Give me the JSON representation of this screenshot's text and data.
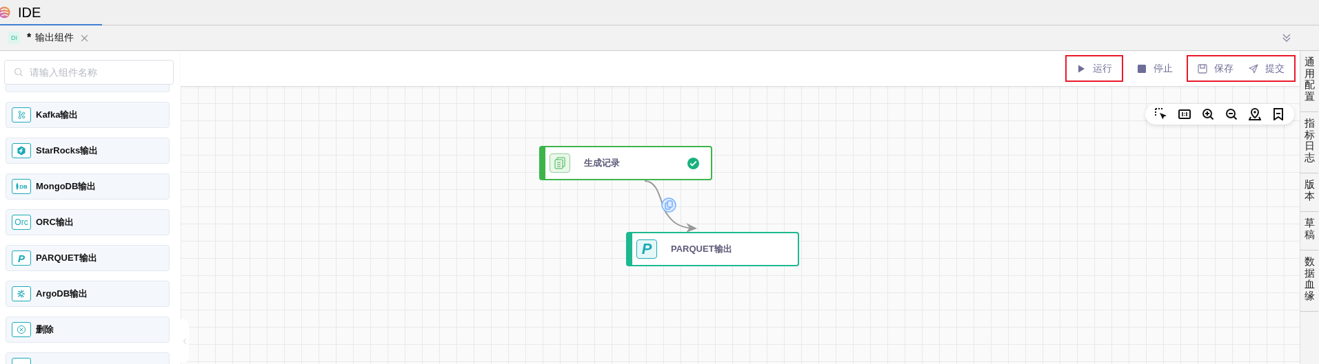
{
  "app": {
    "title": "IDE"
  },
  "tabs": [
    {
      "badge": "DI",
      "dirty_mark": "*",
      "label": "输出组件"
    }
  ],
  "search": {
    "placeholder": "请输入组件名称"
  },
  "components": [
    {
      "kind": "kafka",
      "label": "Kafka输出"
    },
    {
      "kind": "starrocks",
      "label": "StarRocks输出"
    },
    {
      "kind": "mongodb",
      "icon_text": "DB",
      "label": "MongoDB输出"
    },
    {
      "kind": "orc",
      "icon_text": "Orc",
      "label": "ORC输出"
    },
    {
      "kind": "parquet",
      "icon_text": "P",
      "label": "PARQUET输出"
    },
    {
      "kind": "argodb",
      "label": "ArgoDB输出"
    },
    {
      "kind": "delete",
      "label": "删除"
    }
  ],
  "toolbar": {
    "groups": [
      {
        "highlighted": true,
        "buttons": [
          {
            "kind": "run",
            "label": "运行"
          }
        ]
      },
      {
        "highlighted": false,
        "buttons": [
          {
            "kind": "stop",
            "label": "停止"
          }
        ]
      },
      {
        "highlighted": true,
        "buttons": [
          {
            "kind": "save",
            "label": "保存"
          },
          {
            "kind": "submit",
            "label": "提交"
          }
        ]
      }
    ]
  },
  "canvas_tools": [
    {
      "kind": "select"
    },
    {
      "kind": "fit"
    },
    {
      "kind": "zoom-in"
    },
    {
      "kind": "zoom-out"
    },
    {
      "kind": "locate"
    },
    {
      "kind": "bookmark"
    }
  ],
  "nodes": [
    {
      "kind": "records",
      "label": "生成记录",
      "color": "#3bb54a",
      "done": true
    },
    {
      "kind": "parquet",
      "icon_text": "P",
      "label": "PARQUET输出",
      "color": "#1cb98f",
      "done": false
    }
  ],
  "right_tabs": [
    {
      "label": "通用配置"
    },
    {
      "label": "指标日志"
    },
    {
      "label": "版本"
    },
    {
      "label": "草稿"
    },
    {
      "label": "数据血缘"
    }
  ]
}
